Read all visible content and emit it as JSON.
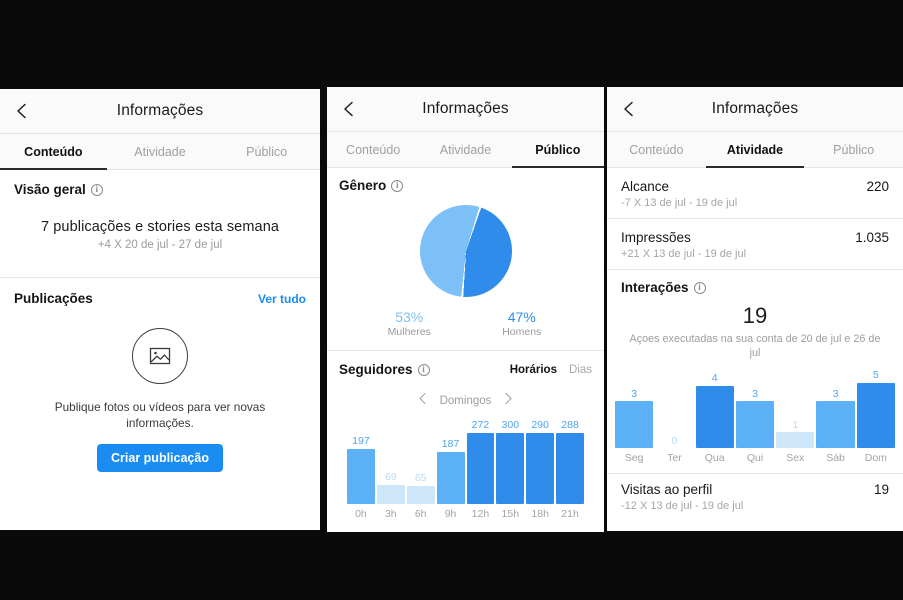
{
  "colors": {
    "accent_blue": "#1a8cf2",
    "bar_dark": "#2f8ceb",
    "bar_mid": "#5cb0f5",
    "bar_pale": "#cde6fa",
    "pie_light": "#7cc0f7",
    "pie_dark": "#2f8ceb",
    "value_label": "#4fa4ef",
    "value_label_faint": "#b7dcf8"
  },
  "panels": [
    {
      "id": "panel-conteudo",
      "nav": {
        "title": "Informações",
        "back_icon": "chevron-left-icon"
      },
      "tabs": [
        {
          "label": "Conteúdo",
          "active": true
        },
        {
          "label": "Atividade",
          "active": false
        },
        {
          "label": "Público",
          "active": false
        }
      ],
      "overview": {
        "heading": "Visão geral",
        "info_icon": "info-icon",
        "headline": "7 publicações e stories esta semana",
        "subline": "+4 X 20 de jul - 27 de jul"
      },
      "publications": {
        "heading": "Publicações",
        "see_all": "Ver tudo",
        "placeholder_icon": "photo-placeholder-icon",
        "empty_text": "Publique fotos ou vídeos para ver novas informações.",
        "cta_label": "Criar publicação"
      }
    },
    {
      "id": "panel-publico",
      "nav": {
        "title": "Informações",
        "back_icon": "chevron-left-icon"
      },
      "tabs": [
        {
          "label": "Conteúdo",
          "active": false
        },
        {
          "label": "Atividade",
          "active": false
        },
        {
          "label": "Público",
          "active": true
        }
      ],
      "gender": {
        "heading": "Gênero",
        "info_icon": "info-icon",
        "legend": [
          {
            "pct": "53%",
            "label": "Mulheres"
          },
          {
            "pct": "47%",
            "label": "Homens"
          }
        ]
      },
      "followers": {
        "heading": "Seguidores",
        "info_icon": "info-icon",
        "toggle": [
          {
            "label": "Horários",
            "active": true
          },
          {
            "label": "Dias",
            "active": false
          }
        ],
        "day_nav": {
          "prev_icon": "chevron-left-icon",
          "label": "Domingos",
          "next_icon": "chevron-right-icon"
        }
      }
    },
    {
      "id": "panel-atividade",
      "nav": {
        "title": "Informações",
        "back_icon": "chevron-left-icon"
      },
      "tabs": [
        {
          "label": "Conteúdo",
          "active": false
        },
        {
          "label": "Atividade",
          "active": true
        },
        {
          "label": "Público",
          "active": false
        }
      ],
      "stats": [
        {
          "name": "Alcance",
          "value": "220",
          "sub": "-7 X 13 de jul - 19 de jul"
        },
        {
          "name": "Impressões",
          "value": "1.035",
          "sub": "+21 X 13 de jul - 19 de jul"
        }
      ],
      "interactions": {
        "heading": "Interações",
        "info_icon": "info-icon",
        "total": "19",
        "description": "Açoes executadas na sua conta de 20 de jul e 26 de jul"
      },
      "profile_visits": {
        "name": "Visitas ao perfil",
        "value": "19",
        "sub": "-12 X 13 de jul - 19 de jul"
      }
    }
  ],
  "chart_data": [
    {
      "type": "pie",
      "title": "Gênero",
      "labels": [
        "Mulheres",
        "Homens"
      ],
      "values": [
        53,
        47
      ],
      "value_labels": [
        "53%",
        "47%"
      ],
      "colors": [
        "#7cc0f7",
        "#2f8ceb"
      ],
      "legend": "below"
    },
    {
      "type": "bar",
      "title": "Seguidores",
      "subtitle": "Domingos",
      "xlabel": "",
      "ylabel": "",
      "categories": [
        "0h",
        "3h",
        "6h",
        "9h",
        "12h",
        "15h",
        "18h",
        "21h"
      ],
      "values": [
        197,
        69,
        65,
        187,
        272,
        300,
        290,
        288
      ],
      "ylim": [
        0,
        300
      ],
      "grid": false,
      "bar_shades": [
        "mid",
        "pale",
        "pale",
        "mid",
        "dark",
        "dark",
        "dark",
        "dark"
      ]
    },
    {
      "type": "bar",
      "title": "Interações",
      "subtitle": "Açoes executadas na sua conta de 20 de jul e 26 de jul",
      "xlabel": "",
      "ylabel": "",
      "categories": [
        "Seg",
        "Ter",
        "Qua",
        "Qui",
        "Sex",
        "Sáb",
        "Dom"
      ],
      "values": [
        3,
        0,
        4,
        3,
        1,
        3,
        5
      ],
      "ylim": [
        0,
        5
      ],
      "grid": false,
      "bar_shades": [
        "mid",
        "none",
        "dark",
        "mid",
        "pale",
        "mid",
        "dark"
      ],
      "total": 19
    }
  ]
}
